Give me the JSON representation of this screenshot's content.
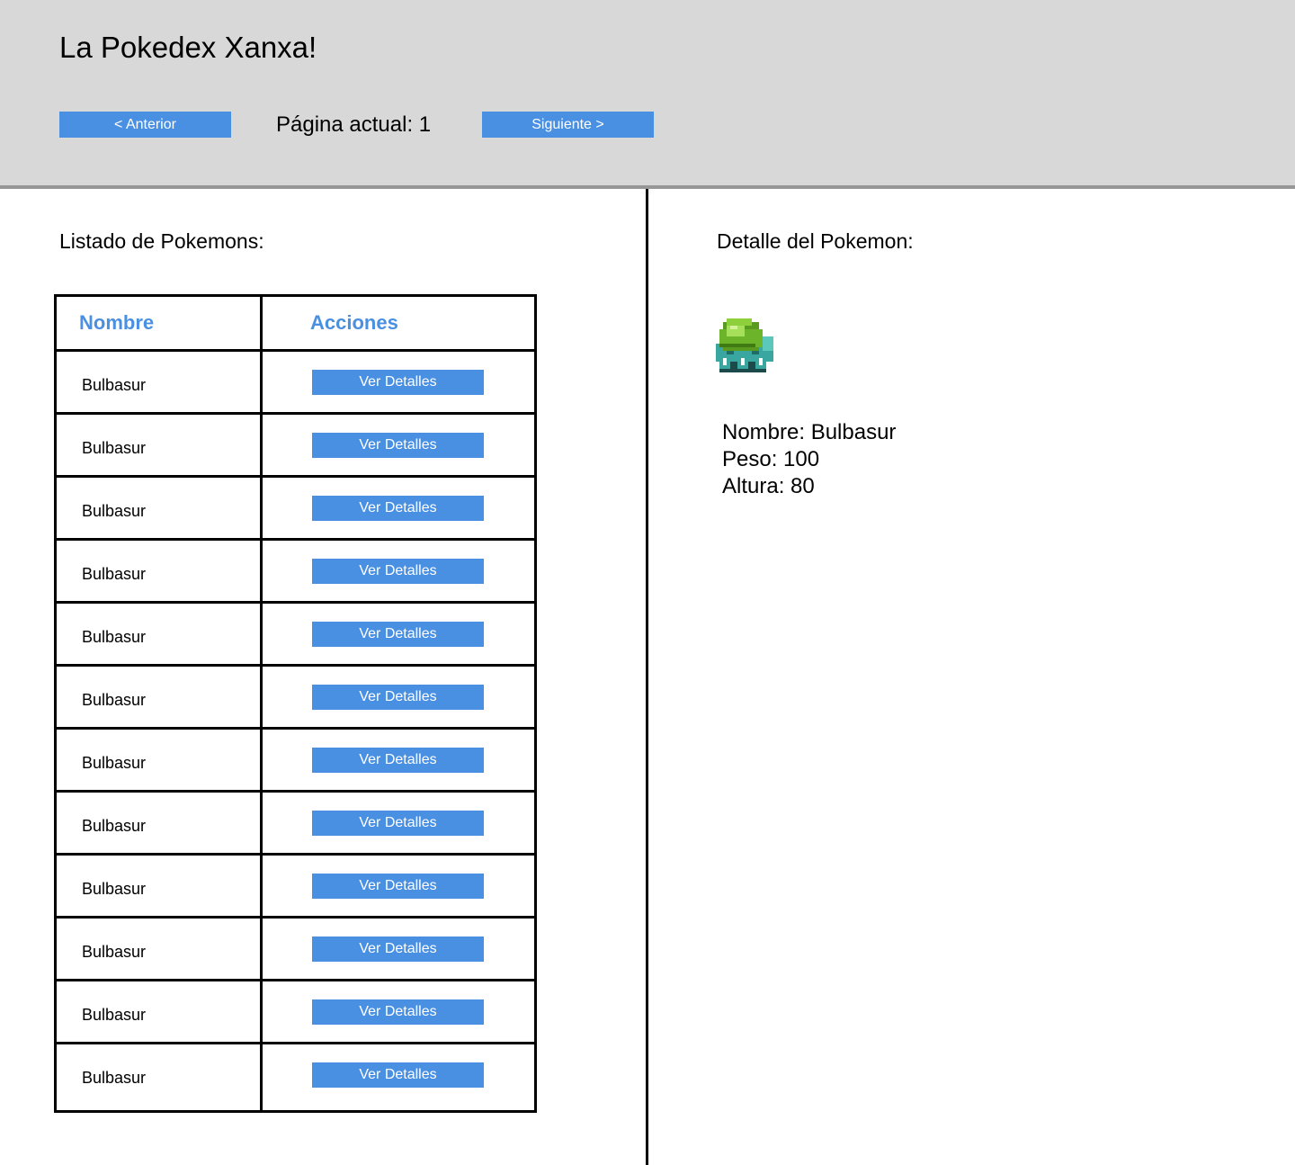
{
  "header": {
    "title": "La Pokedex Xanxa!",
    "prev_label": "< Anterior",
    "page_indicator": "Página actual: 1",
    "next_label": "Siguiente >"
  },
  "list": {
    "title": "Listado de Pokemons:",
    "columns": [
      "Nombre",
      "Acciones"
    ],
    "rows": [
      {
        "name": "Bulbasur",
        "action": "Ver Detalles"
      },
      {
        "name": "Bulbasur",
        "action": "Ver Detalles"
      },
      {
        "name": "Bulbasur",
        "action": "Ver Detalles"
      },
      {
        "name": "Bulbasur",
        "action": "Ver Detalles"
      },
      {
        "name": "Bulbasur",
        "action": "Ver Detalles"
      },
      {
        "name": "Bulbasur",
        "action": "Ver Detalles"
      },
      {
        "name": "Bulbasur",
        "action": "Ver Detalles"
      },
      {
        "name": "Bulbasur",
        "action": "Ver Detalles"
      },
      {
        "name": "Bulbasur",
        "action": "Ver Detalles"
      },
      {
        "name": "Bulbasur",
        "action": "Ver Detalles"
      },
      {
        "name": "Bulbasur",
        "action": "Ver Detalles"
      },
      {
        "name": "Bulbasur",
        "action": "Ver Detalles"
      }
    ]
  },
  "detail": {
    "title": "Detalle del Pokemon:",
    "image": "bulbasaur-sprite",
    "lines": [
      "Nombre: Bulbasur",
      "Peso: 100",
      "Altura: 80"
    ]
  },
  "colors": {
    "accent": "#4a90e2",
    "header_bg": "#d8d8d8",
    "header_border": "#979797"
  }
}
